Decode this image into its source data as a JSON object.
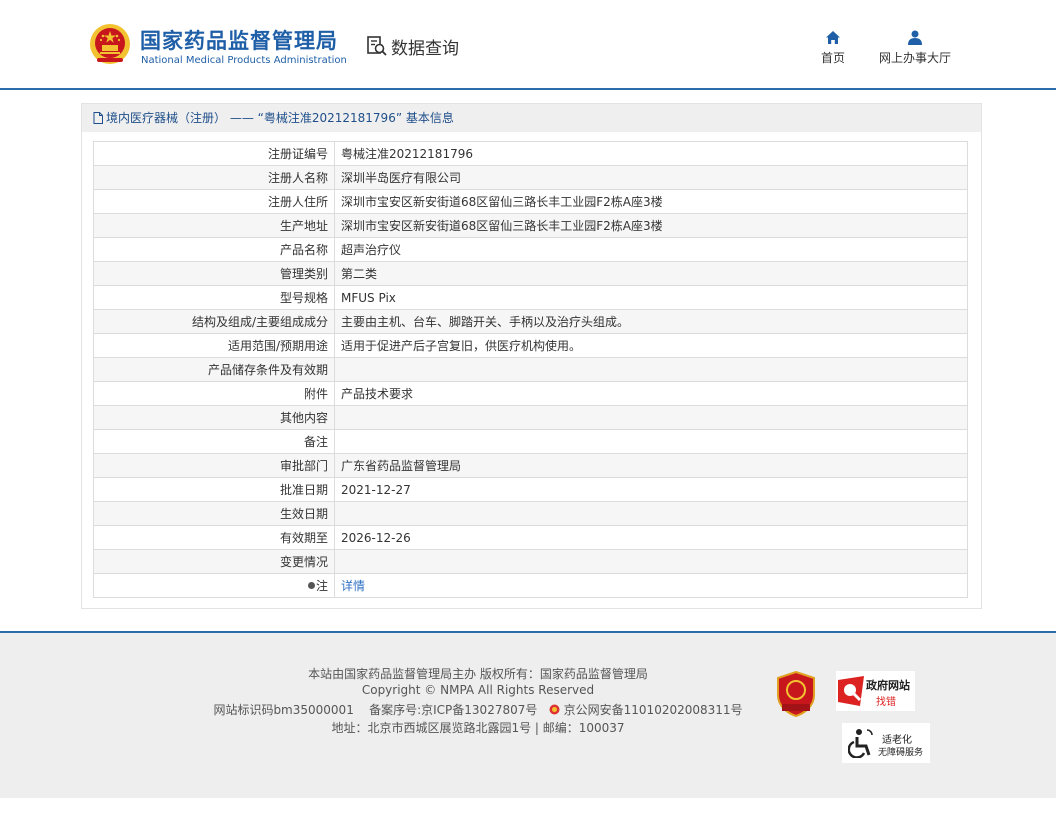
{
  "header": {
    "title_cn": "国家药品监督管理局",
    "title_en": "National Medical Products Administration",
    "data_query": "数据查询",
    "nav": [
      {
        "label": "首页",
        "icon": "home-icon"
      },
      {
        "label": "网上办事大厅",
        "icon": "user-icon"
      }
    ]
  },
  "breadcrumb": "境内医疗器械（注册） —— “粤械注准20212181796” 基本信息",
  "rows": [
    {
      "label": "注册证编号",
      "value": "粤械注准20212181796"
    },
    {
      "label": "注册人名称",
      "value": "深圳半岛医疗有限公司"
    },
    {
      "label": "注册人住所",
      "value": "深圳市宝安区新安街道68区留仙三路长丰工业园F2栋A座3楼"
    },
    {
      "label": "生产地址",
      "value": "深圳市宝安区新安街道68区留仙三路长丰工业园F2栋A座3楼"
    },
    {
      "label": "产品名称",
      "value": "超声治疗仪"
    },
    {
      "label": "管理类别",
      "value": "第二类"
    },
    {
      "label": "型号规格",
      "value": "MFUS Pix"
    },
    {
      "label": "结构及组成/主要组成成分",
      "value": "主要由主机、台车、脚踏开关、手柄以及治疗头组成。"
    },
    {
      "label": "适用范围/预期用途",
      "value": "适用于促进产后子宫复旧，供医疗机构使用。"
    },
    {
      "label": "产品储存条件及有效期",
      "value": ""
    },
    {
      "label": "附件",
      "value": "产品技术要求"
    },
    {
      "label": "其他内容",
      "value": ""
    },
    {
      "label": "备注",
      "value": ""
    },
    {
      "label": "审批部门",
      "value": "广东省药品监督管理局"
    },
    {
      "label": "批准日期",
      "value": "2021-12-27"
    },
    {
      "label": "生效日期",
      "value": ""
    },
    {
      "label": "有效期至",
      "value": "2026-12-26"
    },
    {
      "label": "变更情况",
      "value": ""
    }
  ],
  "note_row": {
    "label": "注",
    "link": "详情"
  },
  "footer": {
    "line1": "本站由国家药品监督管理局主办 版权所有：国家药品监督管理局",
    "line2": "Copyright © NMPA All Rights Reserved",
    "line3_a": "网站标识码bm35000001",
    "line3_b": "备案序号:京ICP备13027807号",
    "line3_c": "京公网安备11010202008311号",
    "line4": "地址：北京市西城区展览路北露园1号 | 邮编：100037",
    "badge_shield": "党政机关",
    "badge_gov_1": "政府网站",
    "badge_gov_2": "找错",
    "badge_acc_1": "适老化",
    "badge_acc_2": "无障碍服务"
  },
  "colors": {
    "brand": "#1f5fa8",
    "rule": "#2d6cab",
    "link": "#2f72c4",
    "emblem_red": "#c8161d",
    "emblem_gold": "#f2c230"
  }
}
